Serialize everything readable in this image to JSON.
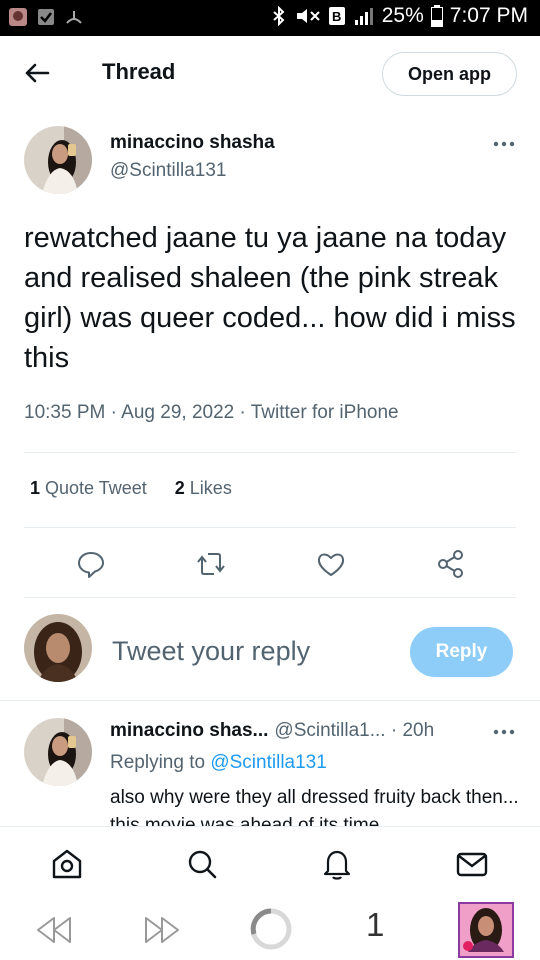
{
  "status_bar": {
    "battery": "25%",
    "time": "7:07 PM"
  },
  "header": {
    "title": "Thread",
    "open_app_label": "Open app"
  },
  "tweet": {
    "author_name": "minaccino shasha",
    "author_handle": "@Scintilla131",
    "text": "rewatched jaane tu ya jaane na today and realised shaleen (the pink streak girl) was queer coded... how did i miss this",
    "meta": "10:35 PM · Aug 29, 2022 · Twitter for iPhone",
    "quote_count": "1",
    "quote_label": "Quote Tweet",
    "like_count": "2",
    "like_label": "Likes"
  },
  "composer": {
    "placeholder": "Tweet your reply",
    "reply_button": "Reply"
  },
  "reply": {
    "author_name": "minaccino shas...",
    "author_handle": "@Scintilla1...",
    "time": " · 20h",
    "replying_prefix": "Replying to ",
    "replying_mention": "@Scintilla131",
    "text": "also why were they all dressed fruity back then... this movie was ahead of its time"
  },
  "browser_bar": {
    "tab_count": "1"
  },
  "colors": {
    "accent": "#1d9bf0",
    "reply_button_disabled": "#8ecdf8",
    "secondary_text": "#536471",
    "divider": "#e6ecf0"
  },
  "icons": {
    "header": [
      "back-arrow-icon"
    ],
    "tweet_actions": [
      "reply-icon",
      "retweet-icon",
      "like-icon",
      "share-icon"
    ],
    "bottom_nav": [
      "home-icon",
      "search-icon",
      "notifications-icon",
      "messages-icon"
    ],
    "browser_bar": [
      "back-icon",
      "forward-icon",
      "reload-icon",
      "tab-count",
      "profile-thumbnail"
    ]
  }
}
